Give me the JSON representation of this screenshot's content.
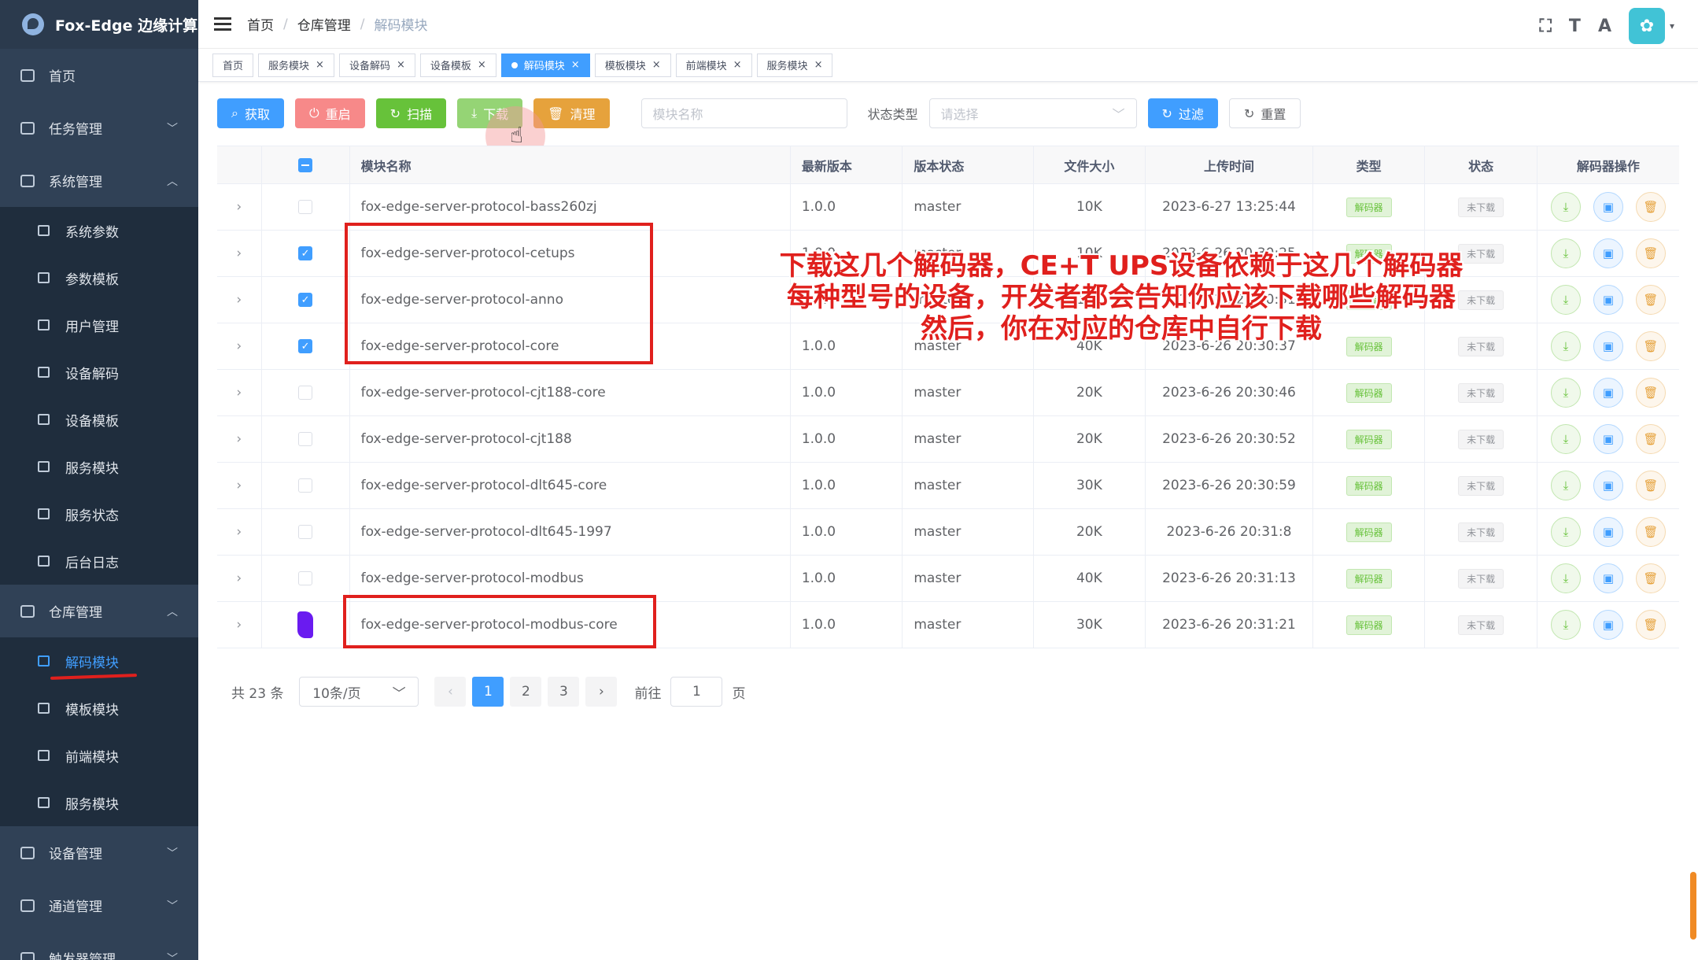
{
  "app": {
    "title": "Fox-Edge 边缘计算"
  },
  "sidebar": {
    "items": [
      {
        "label": "首页"
      },
      {
        "label": "任务管理",
        "chevron": "﹀"
      },
      {
        "label": "系统管理",
        "chevron": "︿"
      },
      {
        "label": "仓库管理",
        "chevron": "︿"
      },
      {
        "label": "设备管理",
        "chevron": "﹀"
      },
      {
        "label": "通道管理",
        "chevron": "﹀"
      },
      {
        "label": "触发器管理",
        "chevron": "﹀"
      }
    ],
    "system_sub": [
      {
        "label": "系统参数"
      },
      {
        "label": "参数模板"
      },
      {
        "label": "用户管理"
      },
      {
        "label": "设备解码"
      },
      {
        "label": "设备模板"
      },
      {
        "label": "服务模块"
      },
      {
        "label": "服务状态"
      },
      {
        "label": "后台日志"
      }
    ],
    "repo_sub": [
      {
        "label": "解码模块",
        "active": true
      },
      {
        "label": "模板模块"
      },
      {
        "label": "前端模块"
      },
      {
        "label": "服务模块"
      }
    ]
  },
  "header": {
    "breadcrumb": [
      "首页",
      "仓库管理",
      "解码模块"
    ],
    "separator": "/",
    "icons": [
      "fullscreen-icon",
      "font-size-icon",
      "translate-icon"
    ],
    "icon_glyphs": [
      "⛶",
      "T",
      "A"
    ],
    "avatar_glyph": "✿",
    "caret": "▾"
  },
  "tags": [
    {
      "label": "首页",
      "closable": false
    },
    {
      "label": "服务模块",
      "closable": true
    },
    {
      "label": "设备解码",
      "closable": true
    },
    {
      "label": "设备模板",
      "closable": true
    },
    {
      "label": "解码模块",
      "closable": true,
      "active": true
    },
    {
      "label": "模板模块",
      "closable": true
    },
    {
      "label": "前端模块",
      "closable": true
    },
    {
      "label": "服务模块",
      "closable": true
    }
  ],
  "toolbar": {
    "fetch": "获取",
    "restart": "重启",
    "scan": "扫描",
    "download": "下载",
    "clean": "清理",
    "module_name_placeholder": "模块名称",
    "status_label": "状态类型",
    "status_placeholder": "请选择",
    "filter": "过滤",
    "reset": "重置"
  },
  "table": {
    "headers": [
      "模块名称",
      "最新版本",
      "版本状态",
      "文件大小",
      "上传时间",
      "类型",
      "状态",
      "解码器操作"
    ],
    "rows": [
      {
        "name": "fox-edge-server-protocol-bass260zj",
        "version": "1.0.0",
        "vstatus": "master",
        "size": "10K",
        "time": "2023-6-27 13:25:44",
        "type": "解码器",
        "status": "未下载",
        "checked": false
      },
      {
        "name": "fox-edge-server-protocol-cetups",
        "version": "1.0.0",
        "vstatus": "master",
        "size": "10K",
        "time": "2023-6-26 20:30:25",
        "type": "解码器",
        "status": "未下载",
        "checked": true
      },
      {
        "name": "fox-edge-server-protocol-anno",
        "version": "1.0.0",
        "vstatus": "master",
        "size": "10K",
        "time": "2023-6-26 20:30:31",
        "type": "解码器",
        "status": "未下载",
        "checked": true
      },
      {
        "name": "fox-edge-server-protocol-core",
        "version": "1.0.0",
        "vstatus": "master",
        "size": "40K",
        "time": "2023-6-26 20:30:37",
        "type": "解码器",
        "status": "未下载",
        "checked": true
      },
      {
        "name": "fox-edge-server-protocol-cjt188-core",
        "version": "1.0.0",
        "vstatus": "master",
        "size": "20K",
        "time": "2023-6-26 20:30:46",
        "type": "解码器",
        "status": "未下载",
        "checked": false
      },
      {
        "name": "fox-edge-server-protocol-cjt188",
        "version": "1.0.0",
        "vstatus": "master",
        "size": "20K",
        "time": "2023-6-26 20:30:52",
        "type": "解码器",
        "status": "未下载",
        "checked": false
      },
      {
        "name": "fox-edge-server-protocol-dlt645-core",
        "version": "1.0.0",
        "vstatus": "master",
        "size": "30K",
        "time": "2023-6-26 20:30:59",
        "type": "解码器",
        "status": "未下载",
        "checked": false
      },
      {
        "name": "fox-edge-server-protocol-dlt645-1997",
        "version": "1.0.0",
        "vstatus": "master",
        "size": "20K",
        "time": "2023-6-26 20:31:8",
        "type": "解码器",
        "status": "未下载",
        "checked": false
      },
      {
        "name": "fox-edge-server-protocol-modbus",
        "version": "1.0.0",
        "vstatus": "master",
        "size": "40K",
        "time": "2023-6-26 20:31:13",
        "type": "解码器",
        "status": "未下载",
        "checked": false
      },
      {
        "name": "fox-edge-server-protocol-modbus-core",
        "version": "1.0.0",
        "vstatus": "master",
        "size": "30K",
        "time": "2023-6-26 20:31:21",
        "type": "解码器",
        "status": "未下载",
        "checked": "marker"
      }
    ]
  },
  "annotation": {
    "line1": "下载这几个解码器，CE+T UPS设备依赖于这几个解码器",
    "line2": "每种型号的设备，开发者都会告知你应该下载哪些解码器",
    "line3": "然后，你在对应的仓库中自行下载"
  },
  "pagination": {
    "total": "共 23 条",
    "page_size": "10条/页",
    "pages": [
      "1",
      "2",
      "3"
    ],
    "current": "1",
    "goto_label": "前往",
    "goto_value": "1",
    "page_suffix": "页"
  },
  "colors": {
    "accent": "#409eff",
    "sidebar": "#304156",
    "annotation": "#e0201d"
  }
}
